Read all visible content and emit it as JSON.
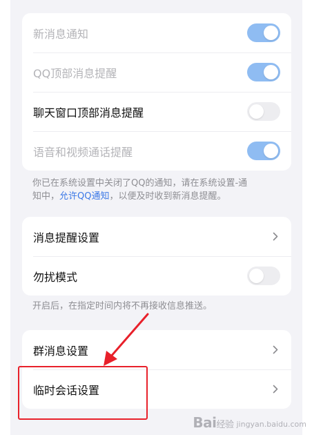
{
  "notification_card": {
    "items": [
      {
        "label": "新消息通知",
        "toggle": "on",
        "disabled": true
      },
      {
        "label": "QQ顶部消息提醒",
        "toggle": "on",
        "disabled": true
      },
      {
        "label": "聊天窗口顶部消息提醒",
        "toggle": "off",
        "disabled": false
      },
      {
        "label": "语音和视频通话提醒",
        "toggle": "on",
        "disabled": true
      }
    ]
  },
  "system_notice": {
    "line1": "你已在系统设置中关闭了QQ的通知，请在系统设置-通",
    "line2_prefix": "知中，",
    "link": "允许QQ通知",
    "line2_suffix": "，以便及时收到新消息提醒。"
  },
  "reminder_card": {
    "items": [
      {
        "label": "消息提醒设置",
        "type": "chevron"
      },
      {
        "label": "勿扰模式",
        "type": "toggle",
        "toggle": "off"
      }
    ]
  },
  "dnd_note": "开启后，在指定时间内将不再接收信息推送。",
  "group_card": {
    "items": [
      {
        "label": "群消息设置",
        "type": "chevron"
      },
      {
        "label": "临时会话设置",
        "type": "chevron"
      }
    ]
  },
  "annotation": {
    "color": "#e8202a"
  },
  "colors": {
    "toggle_on": "#8fbcf2",
    "toggle_off": "#ededf0",
    "link": "#3b78e7",
    "background": "#f3f3f7"
  },
  "watermark": {
    "logo": "Bai",
    "logo_suffix": "经验",
    "subtitle": "jingyan.baidu.com"
  }
}
